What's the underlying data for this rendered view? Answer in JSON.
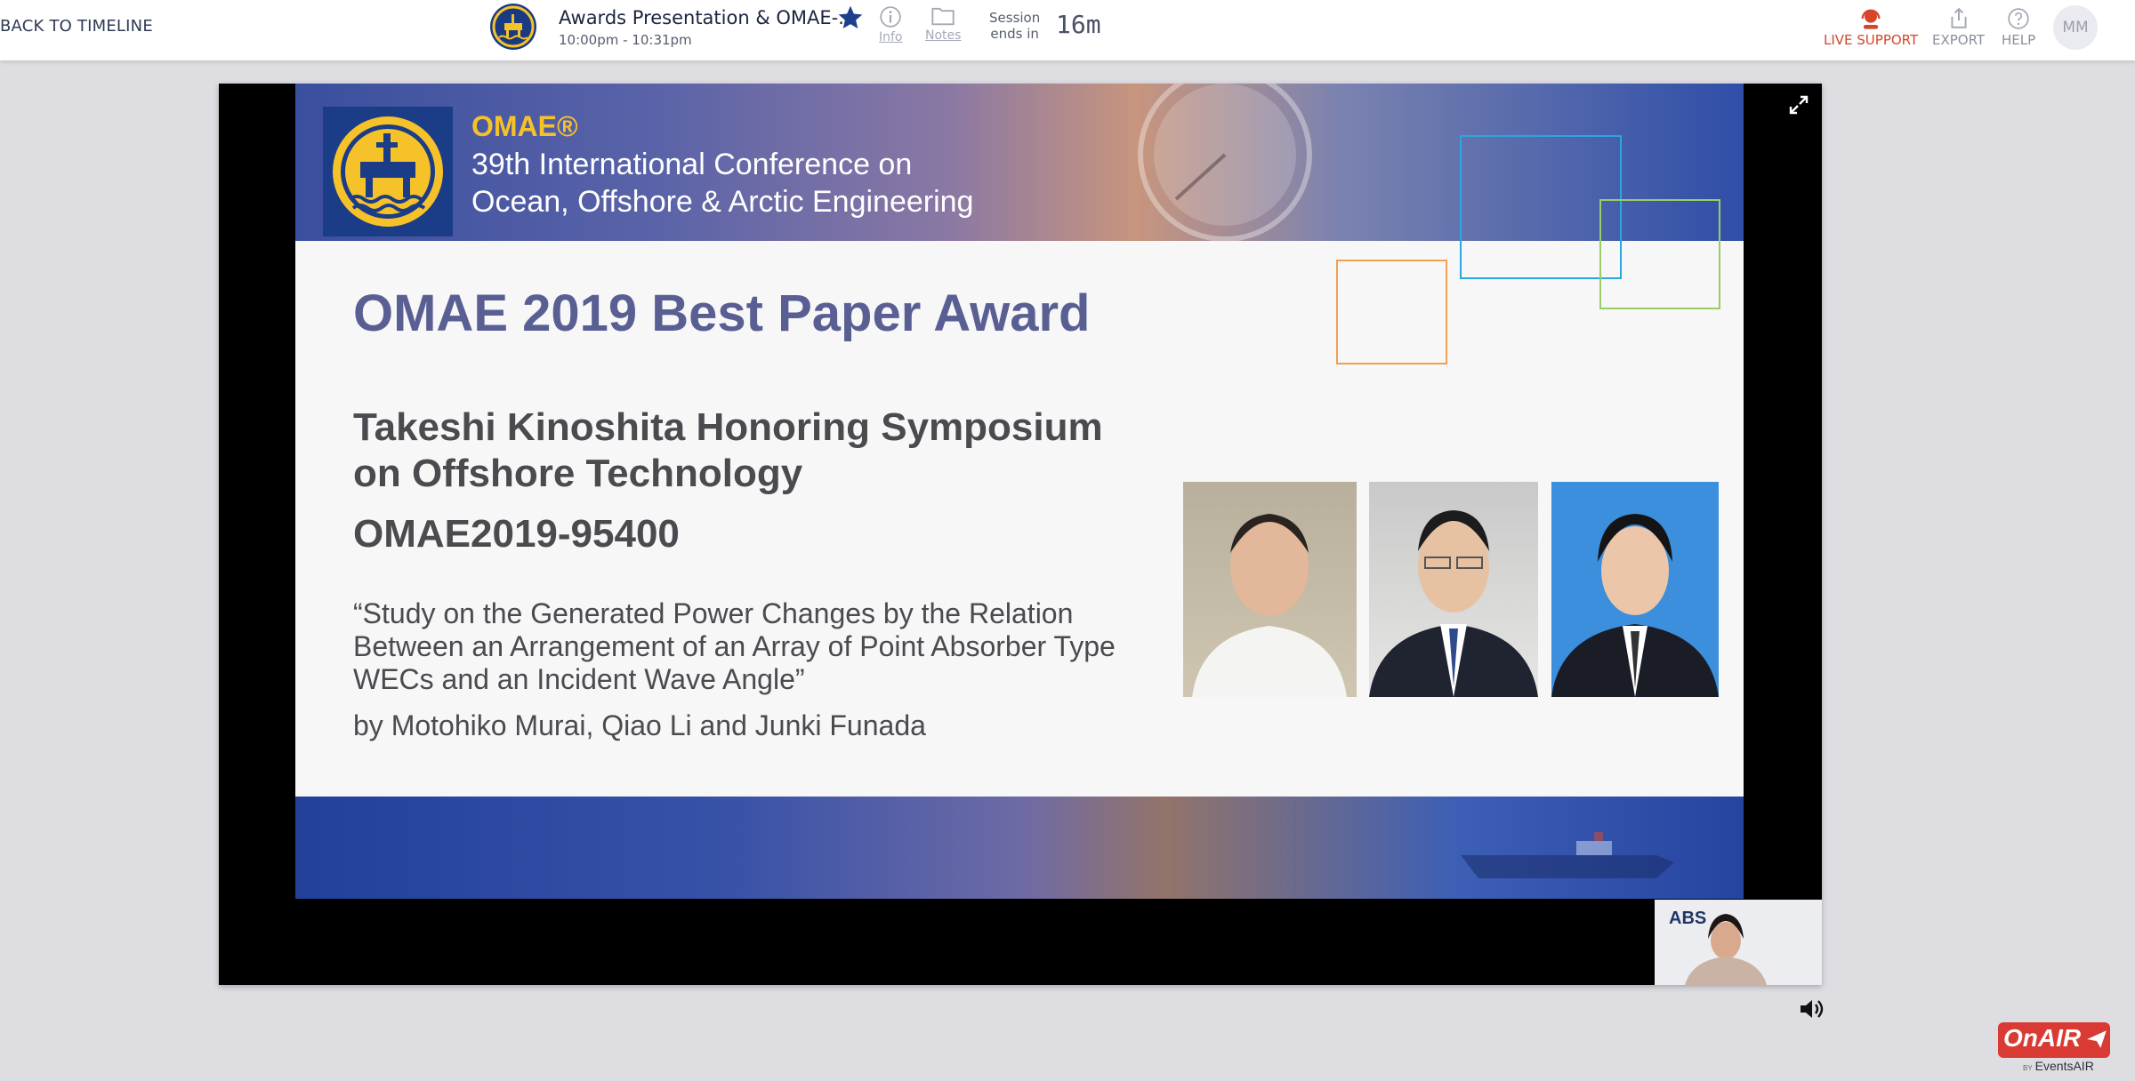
{
  "topbar": {
    "back_label": "BACK TO TIMELINE",
    "session_title": "Awards Presentation & OMAE-...",
    "session_time": "10:00pm - 10:31pm",
    "info_label": "Info",
    "notes_label": "Notes",
    "session_ends_line1": "Session",
    "session_ends_line2": "ends in",
    "session_countdown": "16m",
    "live_support_label": "LIVE SUPPORT",
    "export_label": "EXPORT",
    "help_label": "HELP",
    "avatar_initials": "MM"
  },
  "slide": {
    "header_brand": "OMAE®",
    "header_line1": "39th International Conference on",
    "header_line2": "Ocean, Offshore & Arctic Engineering",
    "award_title": "OMAE 2019 Best Paper Award",
    "symposium_line1": "Takeshi Kinoshita Honoring Symposium",
    "symposium_line2": "on Offshore Technology",
    "paper_id": "OMAE2019-95400",
    "paper_title_line1": "“Study on the Generated Power Changes by the Relation",
    "paper_title_line2": "Between an Arrangement of an Array of Point Absorber Type",
    "paper_title_line3": "WECs and an Incident Wave Angle”",
    "byline": "by Motohiko Murai, Qiao Li and Junki Funada"
  },
  "pip": {
    "logo_text": "ABS"
  },
  "branding": {
    "onair": "OnAIR",
    "by": "BY",
    "eventsair": "EventsAIR"
  },
  "colors": {
    "live_support": "#d5462a",
    "onair_red": "#d93a33",
    "award_title": "#5a5f93",
    "header_gold": "#f6c22a"
  }
}
